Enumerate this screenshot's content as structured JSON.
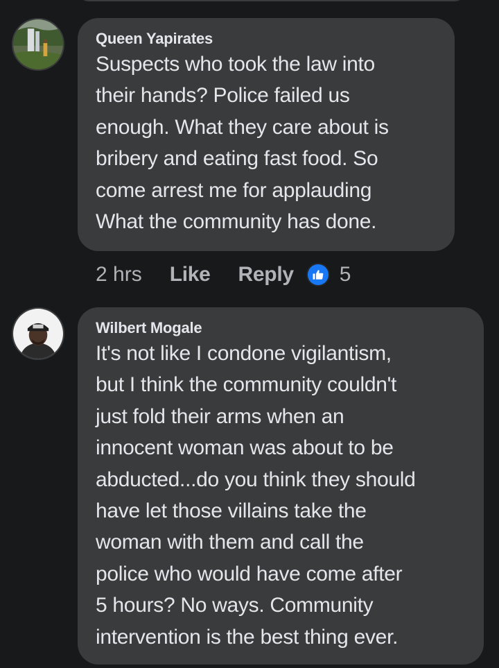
{
  "comments": [
    {
      "author": "Queen Yapirates",
      "text": "Suspects who took the law into\ntheir hands? Police failed us\nenough.  What they care about is\nbribery and eating fast food.  So\ncome arrest me for applauding\nWhat the community has done.",
      "time": "2 hrs",
      "like_label": "Like",
      "reply_label": "Reply",
      "reaction_count": "5",
      "reaction_icon": "thumbs-up-icon"
    },
    {
      "author": "Wilbert Mogale",
      "text": "It's not like I condone vigilantism,\nbut I think the community  couldn't\njust fold their arms when an\ninnocent woman was about to be\nabducted...do you think they should\nhave let those villains take the\nwoman with them and call the\npolice who would have come after\n5 hours? No ways. Community\nintervention is the best thing ever."
    }
  ],
  "colors": {
    "background": "#18191a",
    "bubble": "#3a3b3c",
    "text": "#e4e6eb",
    "secondary_text": "#b0b3b8",
    "like_blue": "#1877f2"
  }
}
